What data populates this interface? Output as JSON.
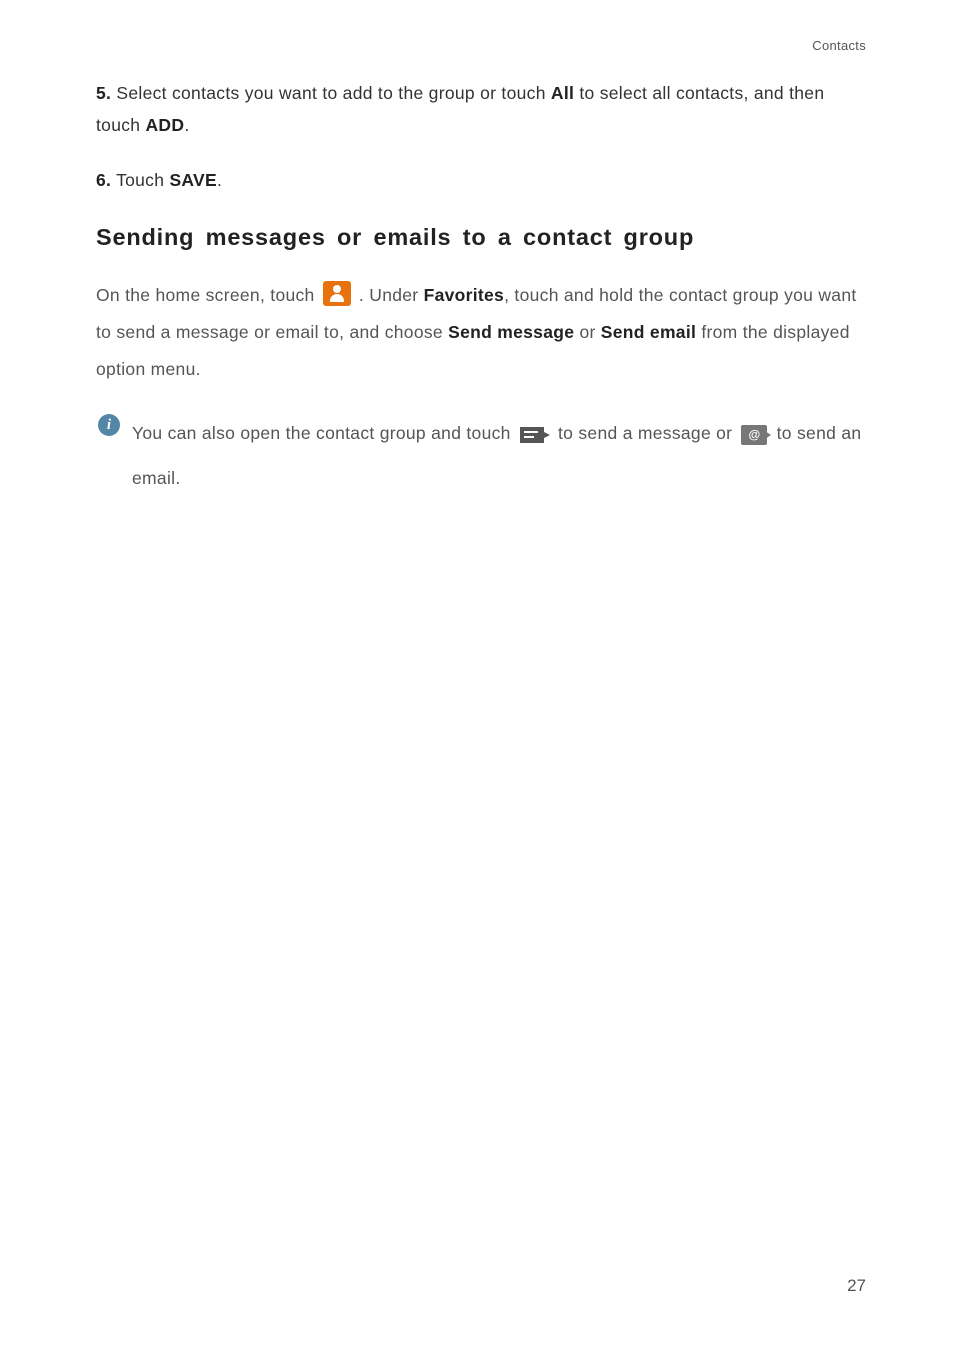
{
  "header": {
    "section_label": "Contacts"
  },
  "steps": {
    "five": {
      "num": "5.",
      "text_a": "Select contacts you want to add to the group or touch ",
      "bold_all": "All",
      "text_b": " to select all contacts, and then touch ",
      "bold_add": "ADD",
      "period": "."
    },
    "six": {
      "num": "6.",
      "text_a": "Touch ",
      "bold_save": "SAVE",
      "period": "."
    }
  },
  "heading": "Sending messages or emails to a contact group",
  "paragraph": {
    "p1a": "On the home screen, touch ",
    "p1b": " . Under ",
    "bold_fav": "Favorites",
    "p1c": ", touch and hold the contact group you want to send a message or email to, and choose ",
    "bold_sendmsg": "Send message",
    "p1d": " or ",
    "bold_sendemail": "Send email",
    "p1e": " from the displayed option menu."
  },
  "note": {
    "icon_label": "i",
    "n1a": "You can also open the contact group and touch ",
    "n1b": " to send a message or ",
    "n1c": " to send an email."
  },
  "page_number": "27"
}
